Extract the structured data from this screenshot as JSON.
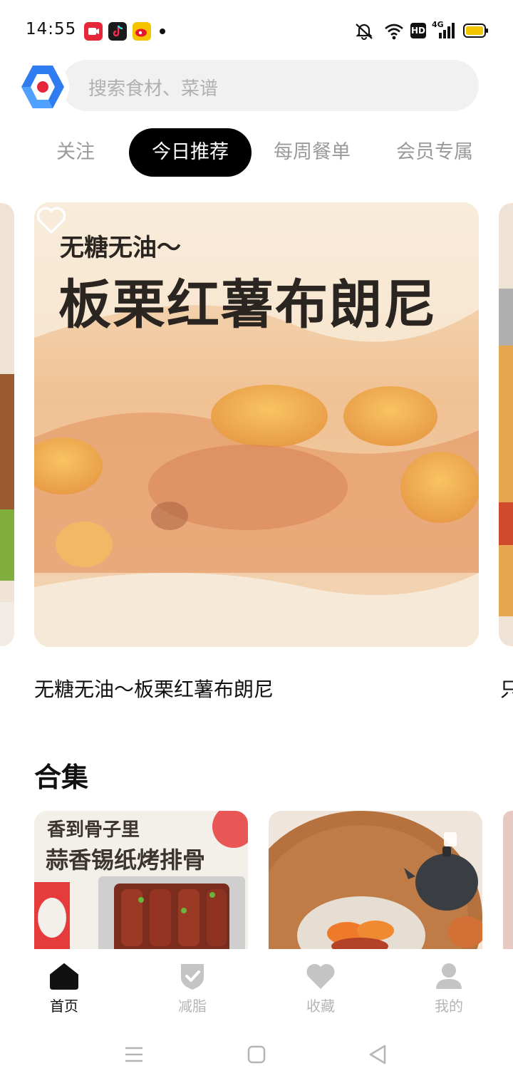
{
  "status_bar": {
    "time": "14:55",
    "app_icons": [
      "screen-recorder-icon",
      "tiktok-icon",
      "weibo-icon"
    ],
    "indicators": [
      "mute-icon",
      "wifi-icon",
      "hd-icon",
      "4g-signal-icon",
      "battery-icon"
    ],
    "network_label": "4G",
    "hd_label": "HD"
  },
  "search": {
    "placeholder": "搜索食材、菜谱"
  },
  "tabs": [
    {
      "label": "关注",
      "active": false
    },
    {
      "label": "今日推荐",
      "active": true
    },
    {
      "label": "每周餐单",
      "active": false
    },
    {
      "label": "会员专属",
      "active": false
    }
  ],
  "featured": {
    "overlay_subtitle": "无糖无油～",
    "overlay_title": "板栗红薯布朗尼",
    "title": "无糖无油～板栗红薯布朗尼",
    "next_title_fragment": "只"
  },
  "collections": {
    "title": "合集",
    "items": [
      {
        "subtitle": "香到骨子里",
        "title": "蒜香锡纸烤排骨"
      },
      {
        "subtitle": "",
        "title": ""
      }
    ]
  },
  "bottom_nav": [
    {
      "label": "首页",
      "icon": "home-icon",
      "active": true
    },
    {
      "label": "减脂",
      "icon": "shield-check-icon",
      "active": false
    },
    {
      "label": "收藏",
      "icon": "heart-icon",
      "active": false
    },
    {
      "label": "我的",
      "icon": "user-icon",
      "active": false
    }
  ],
  "colors": {
    "accent": "#000000",
    "inactive": "#b5b5b5",
    "search_bg": "#f1f1f1",
    "logo_blue": "#2f7bf0",
    "logo_red": "#e8263a"
  }
}
